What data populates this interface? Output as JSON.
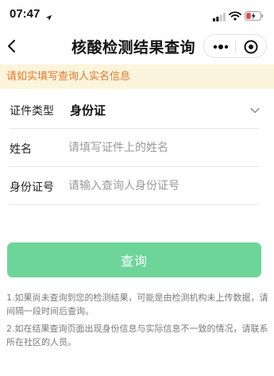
{
  "status_bar": {
    "time": "07:47",
    "icons": [
      "location-arrow-icon",
      "signal-icon",
      "wifi-icon",
      "battery-charging-icon"
    ],
    "battery_color": "#e0473c"
  },
  "nav": {
    "title": "核酸检测结果查询",
    "icons": [
      "back-arrow-icon",
      "more-dots-icon",
      "target-circle-icon"
    ]
  },
  "notice": {
    "text": "请如实填写查询人实名信息",
    "text_color": "#e07b2a",
    "background": "#fdf4dc"
  },
  "form": {
    "id_type": {
      "label": "证件类型",
      "value": "身份证"
    },
    "name": {
      "label": "姓名",
      "placeholder": "请填写证件上的姓名"
    },
    "id_number": {
      "label": "身份证号",
      "placeholder": "请输入查询人身份证号"
    }
  },
  "submit": {
    "label": "查询",
    "color": "#6dd59a"
  },
  "tips": [
    "1.如果尚未查询到您的检测结果，可能是由检测机构未上传数据，请间隔一段时间后查询。",
    "2.如在结果查询页面出现身份信息与实际信息不一致的情况，请联系所在社区的人员。"
  ]
}
